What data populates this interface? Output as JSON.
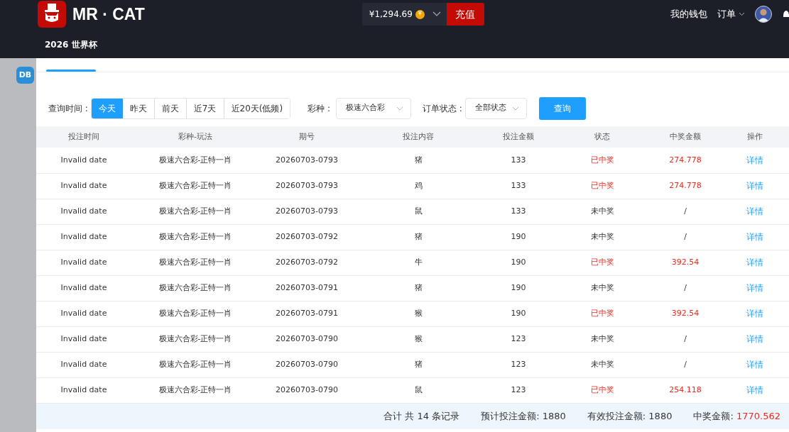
{
  "header": {
    "brand": "MR · CAT",
    "balance": "¥1,294.69",
    "coin": "¥",
    "recharge": "充值",
    "wallet": "我的钱包",
    "orders": "订单",
    "nav": [
      "2026 世界杯"
    ]
  },
  "backdrop": {
    "logo": "DB"
  },
  "filters": {
    "time_label": "查询时间 :",
    "ranges": [
      {
        "label": "今天",
        "selected": true
      },
      {
        "label": "昨天",
        "selected": false
      },
      {
        "label": "前天",
        "selected": false
      },
      {
        "label": "近7天",
        "selected": false
      },
      {
        "label": "近20天(低频)",
        "selected": false
      }
    ],
    "lottery_label": "彩种 :",
    "lottery_value": "极速六合彩",
    "status_label": "订单状态 :",
    "status_value": "全部状态",
    "query": "查询"
  },
  "table": {
    "columns": [
      "投注时间",
      "彩种-玩法",
      "期号",
      "投注内容",
      "投注金额",
      "状态",
      "中奖金额",
      "操作"
    ],
    "rows": [
      {
        "time": "Invalid date",
        "game": "极速六合彩-正特一肖",
        "issue": "20260703-0793",
        "content": "猪",
        "amount": "133",
        "status": "已中奖",
        "won": true,
        "prize": "274.778",
        "action": "详情"
      },
      {
        "time": "Invalid date",
        "game": "极速六合彩-正特一肖",
        "issue": "20260703-0793",
        "content": "鸡",
        "amount": "133",
        "status": "已中奖",
        "won": true,
        "prize": "274.778",
        "action": "详情"
      },
      {
        "time": "Invalid date",
        "game": "极速六合彩-正特一肖",
        "issue": "20260703-0793",
        "content": "鼠",
        "amount": "133",
        "status": "未中奖",
        "won": false,
        "prize": "/",
        "action": "详情"
      },
      {
        "time": "Invalid date",
        "game": "极速六合彩-正特一肖",
        "issue": "20260703-0792",
        "content": "猪",
        "amount": "190",
        "status": "未中奖",
        "won": false,
        "prize": "/",
        "action": "详情"
      },
      {
        "time": "Invalid date",
        "game": "极速六合彩-正特一肖",
        "issue": "20260703-0792",
        "content": "牛",
        "amount": "190",
        "status": "已中奖",
        "won": true,
        "prize": "392.54",
        "action": "详情"
      },
      {
        "time": "Invalid date",
        "game": "极速六合彩-正特一肖",
        "issue": "20260703-0791",
        "content": "猪",
        "amount": "190",
        "status": "未中奖",
        "won": false,
        "prize": "/",
        "action": "详情"
      },
      {
        "time": "Invalid date",
        "game": "极速六合彩-正特一肖",
        "issue": "20260703-0791",
        "content": "猴",
        "amount": "190",
        "status": "已中奖",
        "won": true,
        "prize": "392.54",
        "action": "详情"
      },
      {
        "time": "Invalid date",
        "game": "极速六合彩-正特一肖",
        "issue": "20260703-0790",
        "content": "猴",
        "amount": "123",
        "status": "未中奖",
        "won": false,
        "prize": "/",
        "action": "详情"
      },
      {
        "time": "Invalid date",
        "game": "极速六合彩-正特一肖",
        "issue": "20260703-0790",
        "content": "猪",
        "amount": "123",
        "status": "未中奖",
        "won": false,
        "prize": "/",
        "action": "详情"
      },
      {
        "time": "Invalid date",
        "game": "极速六合彩-正特一肖",
        "issue": "20260703-0790",
        "content": "鼠",
        "amount": "123",
        "status": "已中奖",
        "won": true,
        "prize": "254.118",
        "action": "详情"
      }
    ]
  },
  "summary": {
    "total": "合计 共 14 条记录",
    "expected": "预计投注金额: 1880",
    "valid": "有效投注金额: 1880",
    "prize_label": "中奖金额:",
    "prize_value": "1770.562"
  }
}
